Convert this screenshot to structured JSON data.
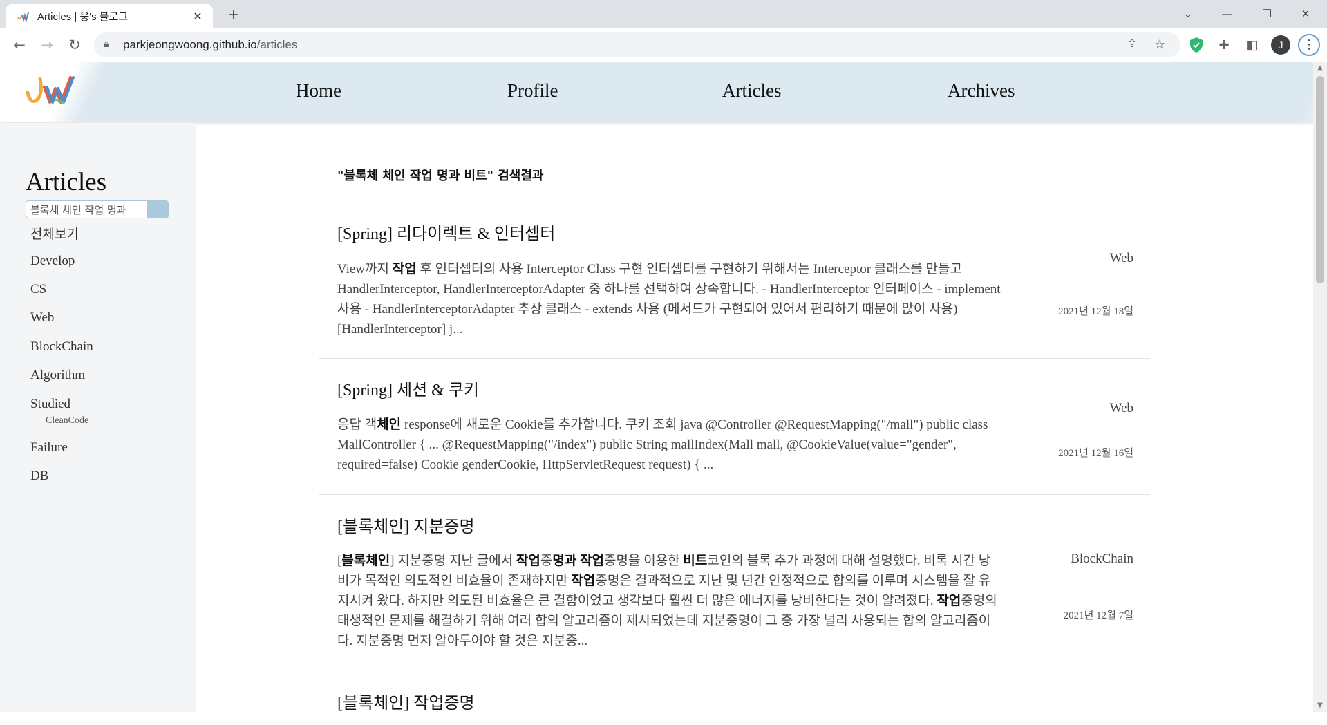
{
  "browser": {
    "tab_title": "Articles | 웅's 블로그",
    "tab_close": "✕",
    "new_tab": "+",
    "url_domain": "parkjeongwoong.github.io",
    "url_path": "/articles",
    "profile_initial": "J",
    "window": {
      "dropdown": "⌄",
      "minimize": "—",
      "restore": "❐",
      "close": "✕"
    },
    "nav": {
      "back": "←",
      "forward": "→",
      "reload": "↻"
    },
    "icons": [
      "lock-icon",
      "share-icon",
      "star-icon",
      "shield-extension-icon",
      "puzzle-extensions-icon",
      "side-panel-icon",
      "menu-icon"
    ]
  },
  "site": {
    "logo_text": "JW",
    "nav": [
      "Home",
      "Profile",
      "Articles",
      "Archives"
    ]
  },
  "sidebar": {
    "title": "Articles",
    "search_value": "블록체 체인 작업 명과",
    "categories": [
      "전체보기",
      "Develop",
      "CS",
      "Web",
      "BlockChain",
      "Algorithm",
      "Studied",
      "Failure",
      "DB"
    ],
    "subcategory": "CleanCode"
  },
  "main": {
    "result_heading": "\"블록체 체인 작업 명과 비트\" 검색결과",
    "posts": [
      {
        "title": "[Spring] 리다이렉트 & 인터셉터",
        "category": "Web",
        "date": "2021년 12월 18일",
        "excerpt_html": "View까지 <b>작업</b> 후 인터셉터의 사용 Interceptor Class 구현 인터셉터를 구현하기 위해서는 Interceptor 클래스를 만들고 HandlerInterceptor, HandlerInterceptorAdapter 중 하나를 선택하여 상속합니다. - HandlerInterceptor 인터페이스 - implement 사용 - HandlerInterceptorAdapter 추상 클래스 - extends 사용 (메서드가 구현되어 있어서 편리하기 때문에 많이 사용) [HandlerInterceptor] j..."
      },
      {
        "title": "[Spring] 세션 & 쿠키",
        "category": "Web",
        "date": "2021년 12월 16일",
        "excerpt_html": "응답 객<b>체인</b> response에 새로운 Cookie를 추가합니다. 쿠키 조회 java @Controller @RequestMapping(\"/mall\") public class MallController { ... @RequestMapping(\"/index\") public String mallIndex(Mall mall, @CookieValue(value=\"gender\", required=false) Cookie genderCookie, HttpServletRequest request) { ..."
      },
      {
        "title": "[블록체인] 지분증명",
        "category": "BlockChain",
        "date": "2021년 12월 7일",
        "excerpt_html": "[<b>블록체인</b>] 지분증명 지난 글에서 <b>작업</b>증<b>명과 작업</b>증명을 이용한 <b>비트</b>코인의 블록 추가 과정에 대해 설명했다. 비록 시간 낭비가 목적인 의도적인 비효율이 존재하지만 <b>작업</b>증명은 결과적으로 지난 몇 년간 안정적으로 합의를 이루며 시스템을 잘 유지시켜 왔다. 하지만 의도된 비효율은 큰 결함이었고 생각보다 훨씬 더 많은 에너지를 낭비한다는 것이 알려졌다. <b>작업</b>증명의 태생적인 문제를 해결하기 위해 여러 합의 알고리즘이 제시되었는데 지분증명이 그 중 가장 널리 사용되는 합의 알고리즘이다. 지분증명 먼저 알아두어야 할 것은 지분증..."
      },
      {
        "title": "[블록체인] 작업증명"
      }
    ]
  }
}
